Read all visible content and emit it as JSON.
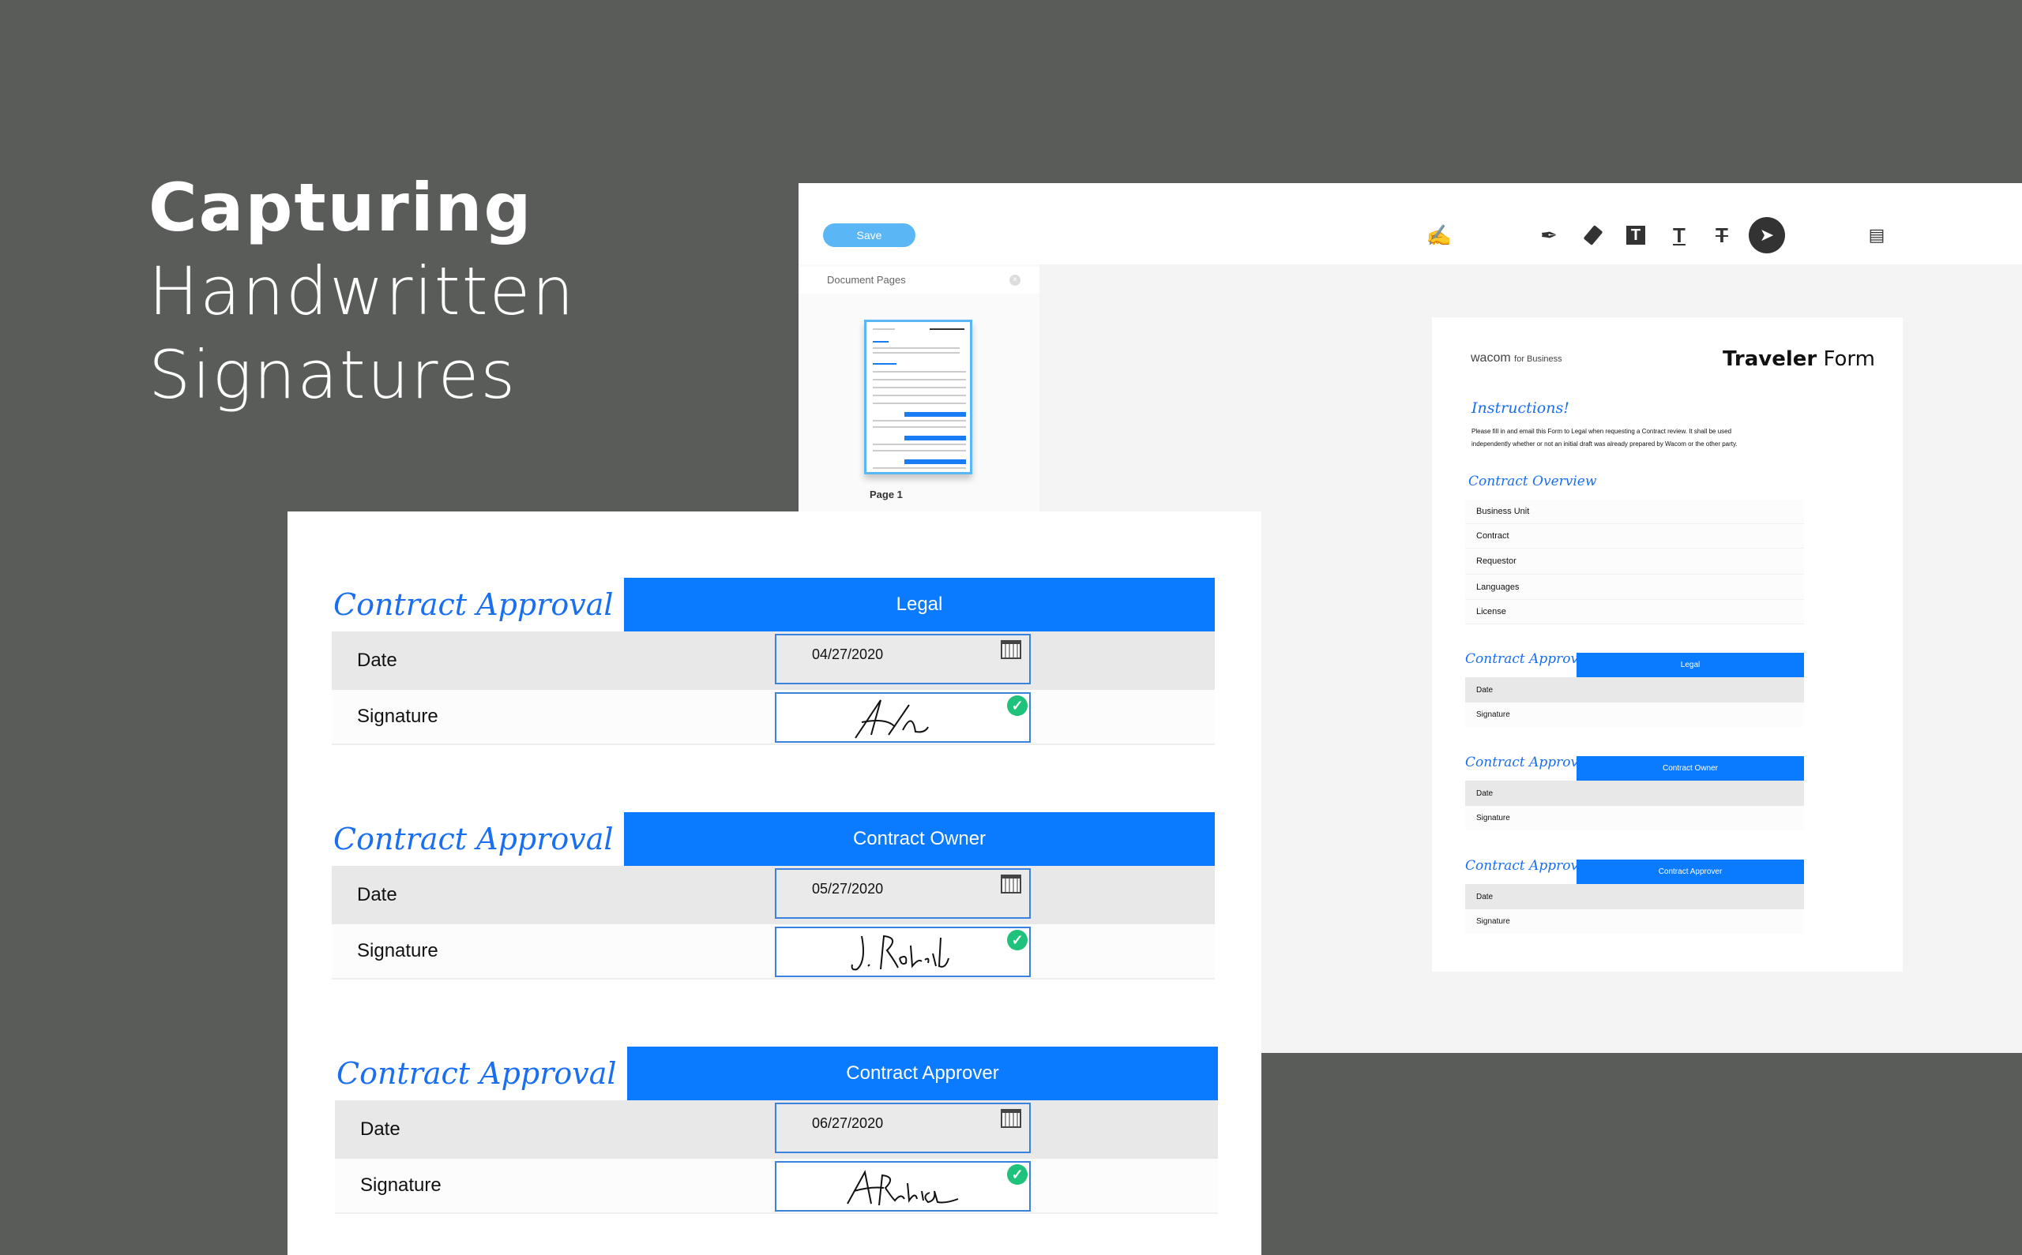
{
  "hero": {
    "line1": "Capturing",
    "line2": "Handwritten",
    "line3": "Signatures"
  },
  "toolbar": {
    "save_label": "Save",
    "tools": [
      "signature-pen-icon",
      "pen-icon",
      "eraser-icon",
      "text-box-icon",
      "text-underline-icon",
      "text-strikethrough-icon",
      "select-cursor-icon",
      "comment-icon"
    ]
  },
  "sidebar": {
    "title": "Document Pages",
    "close": "×",
    "page_label": "Page 1"
  },
  "document": {
    "brand": "wacom",
    "brand_suffix": "for Business",
    "title_bold": "Traveler",
    "title_light": "Form",
    "instructions_heading": "Instructions!",
    "instructions_line1": "Please fill in and email this Form to Legal when requesting a Contract review. It shall be used",
    "instructions_line2": "independently whether or not an initial draft was already prepared by Wacom or the other party.",
    "overview_heading": "Contract Overview",
    "overview_rows": [
      "Business Unit",
      "Contract",
      "Requestor",
      "Languages",
      "License"
    ],
    "sections": [
      {
        "title": "Contract Approval",
        "role": "Legal",
        "date_label": "Date",
        "signature_label": "Signature"
      },
      {
        "title": "Contract Approval",
        "role": "Contract Owner",
        "date_label": "Date",
        "signature_label": "Signature"
      },
      {
        "title": "Contract Approval",
        "role": "Contract Approver",
        "date_label": "Date",
        "signature_label": "Signature"
      }
    ]
  },
  "card": {
    "sections": [
      {
        "title": "Contract Approval",
        "role": "Legal",
        "date_label": "Date",
        "date_value": "04/27/2020",
        "signature_label": "Signature",
        "signed": true
      },
      {
        "title": "Contract Approval",
        "role": "Contract Owner",
        "date_label": "Date",
        "date_value": "05/27/2020",
        "signature_label": "Signature",
        "signed": true
      },
      {
        "title": "Contract Approval",
        "role": "Contract Approver",
        "date_label": "Date",
        "date_value": "06/27/2020",
        "signature_label": "Signature",
        "signed": true
      }
    ]
  },
  "colors": {
    "background": "#5a5c5a",
    "accent": "#0a7aff",
    "save": "#5ab6f5",
    "check": "#1fc27a"
  }
}
